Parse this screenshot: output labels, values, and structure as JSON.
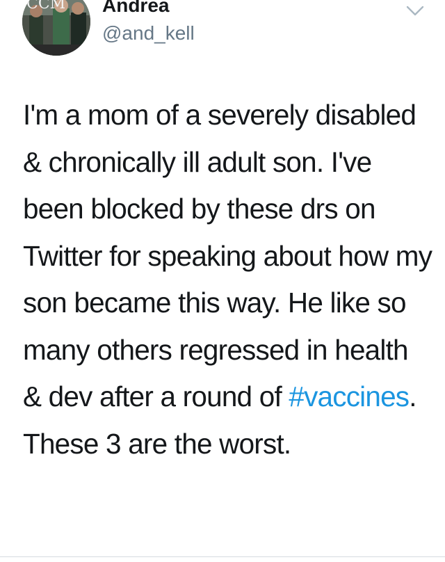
{
  "tweet": {
    "avatar_text": "CCM",
    "display_name": "Andrea",
    "handle": "@and_kell",
    "text_before_hashtag": "I'm a mom of a severely disabled & chronically ill adult son. I've been blocked by these drs on Twitter for speaking about how my son became this way. He like so many others regressed in health & dev after a round of ",
    "hashtag": "#vaccines",
    "text_after_hashtag": ". These 3 are the worst."
  },
  "icons": {
    "avatar": "profile-photo",
    "caret": "chevron-down-icon"
  },
  "colors": {
    "text": "#14171a",
    "secondary_text": "#657786",
    "hashtag": "#1b95e0",
    "background": "#ffffff"
  }
}
